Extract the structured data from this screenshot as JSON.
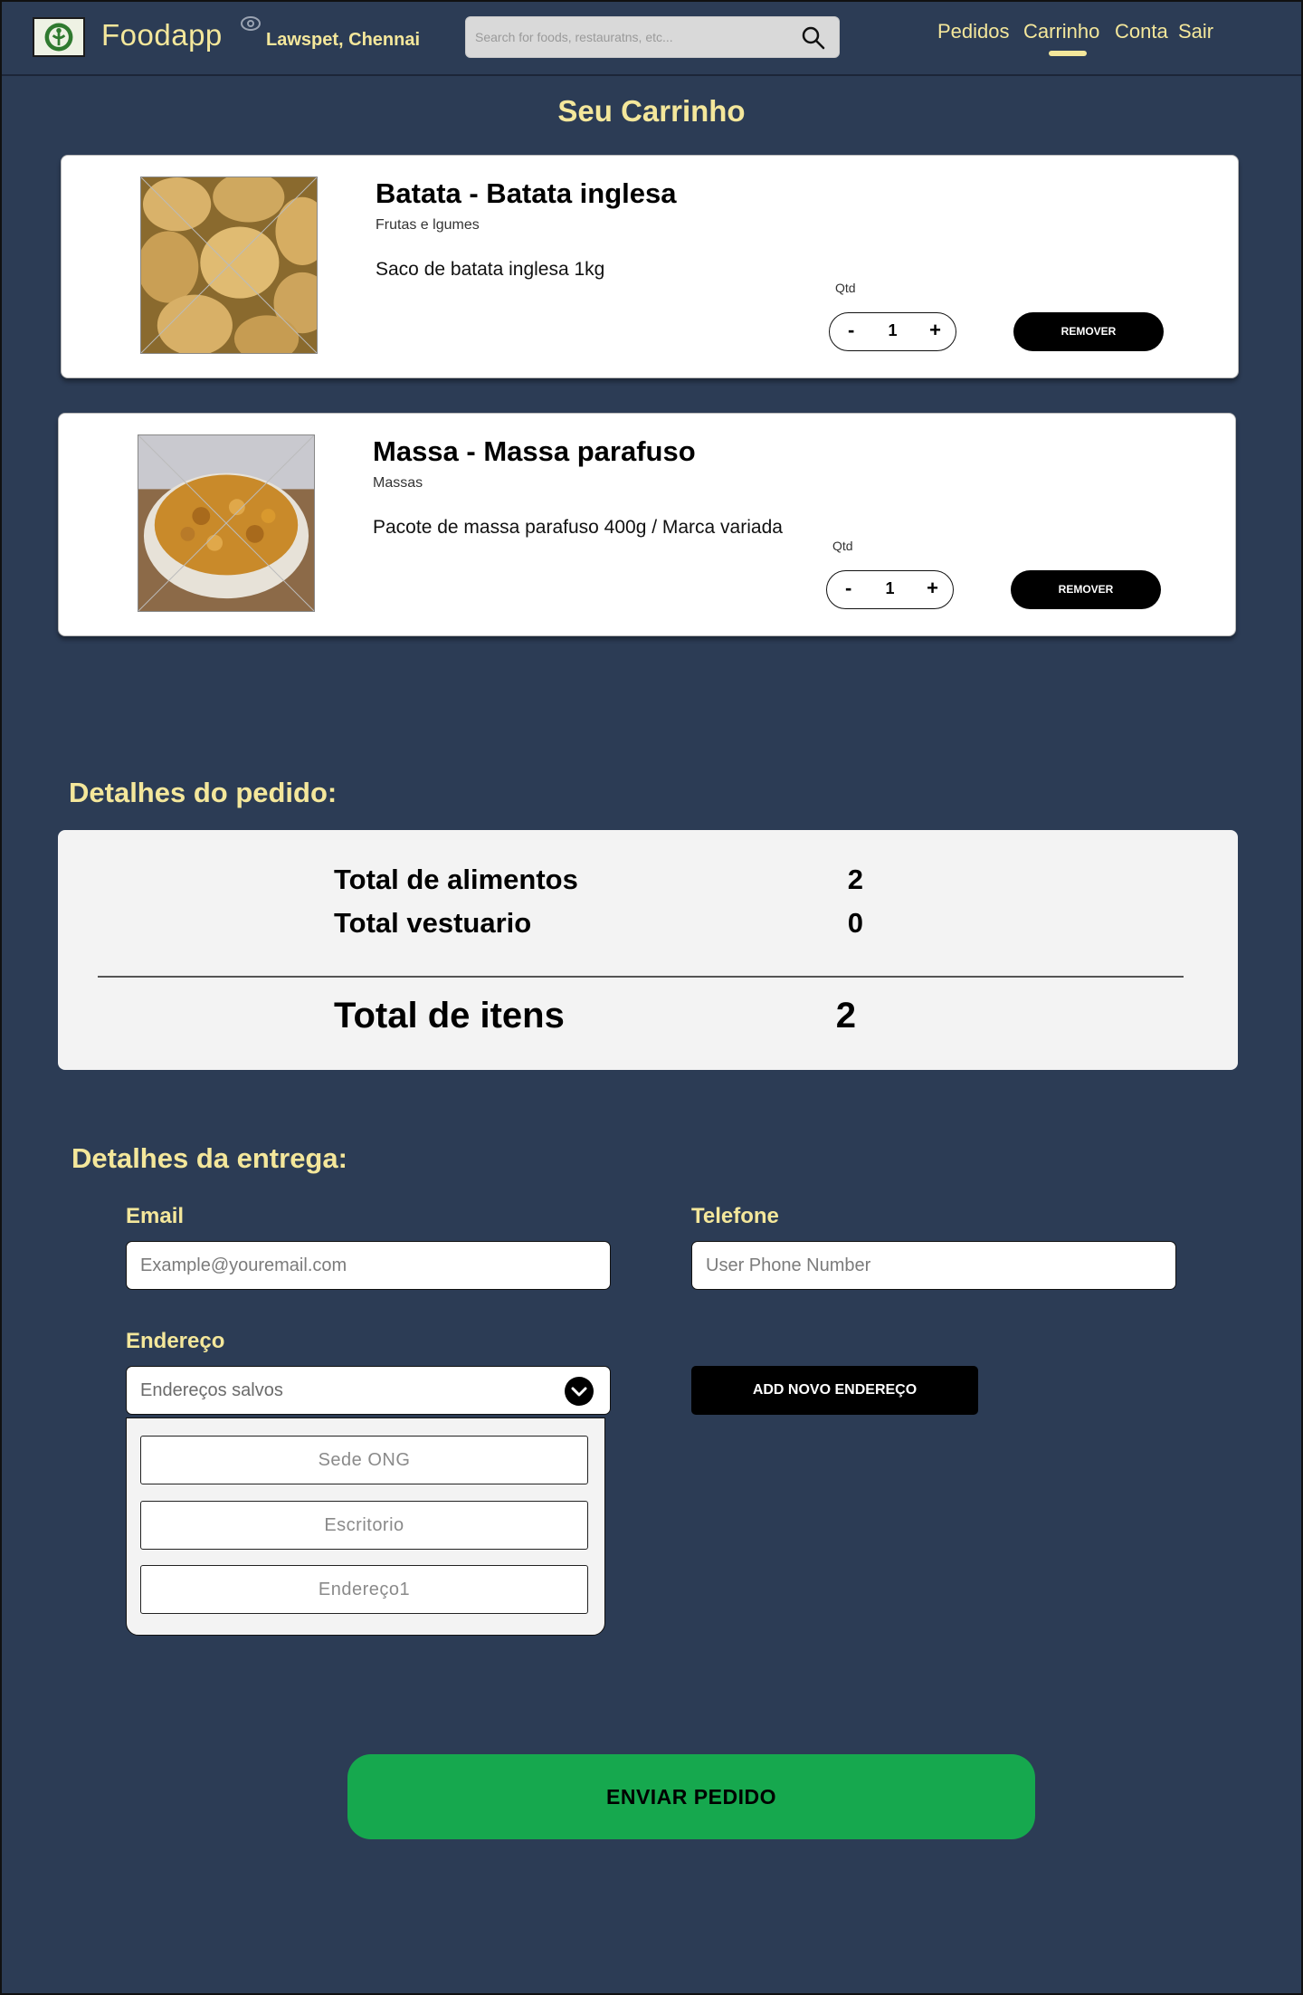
{
  "header": {
    "brand": "Foodapp",
    "location": "Lawspet, Chennai",
    "search_placeholder": "Search for foods, restauratns, etc...",
    "nav": [
      "Pedidos",
      "Carrinho",
      "Conta",
      "Sair"
    ],
    "active_nav": "Carrinho"
  },
  "cart": {
    "title": "Seu Carrinho",
    "qty_label": "Qtd",
    "remove_label": "REMOVER",
    "items": [
      {
        "title": "Batata - Batata inglesa",
        "category": "Frutas e lgumes",
        "description": "Saco de batata inglesa 1kg",
        "quantity": "1",
        "minus": "-",
        "plus": "+"
      },
      {
        "title": "Massa - Massa parafuso",
        "category": "Massas",
        "description": "Pacote de massa parafuso 400g / Marca variada",
        "quantity": "1",
        "minus": "-",
        "plus": "+"
      }
    ]
  },
  "order": {
    "title": "Detalhes do pedido:",
    "rows": [
      {
        "label": "Total de alimentos",
        "value": "2"
      },
      {
        "label": "Total vestuario",
        "value": "0"
      }
    ],
    "total_label": "Total de itens",
    "total_value": "2"
  },
  "delivery": {
    "title": "Detalhes da entrega:",
    "email_label": "Email",
    "email_placeholder": "Example@youremail.com",
    "phone_label": "Telefone",
    "phone_placeholder": "User Phone Number",
    "address_label": "Endereço",
    "address_select": "Endereços salvos",
    "address_options": [
      "Sede ONG",
      "Escritorio",
      "Endereço1"
    ],
    "add_address_label": "ADD NOVO ENDEREÇO"
  },
  "submit_label": "ENVIAR PEDIDO",
  "colors": {
    "background": "#2c3c55",
    "accent_text": "#f4e79b",
    "submit": "#16a84e",
    "button_dark": "#000000"
  }
}
